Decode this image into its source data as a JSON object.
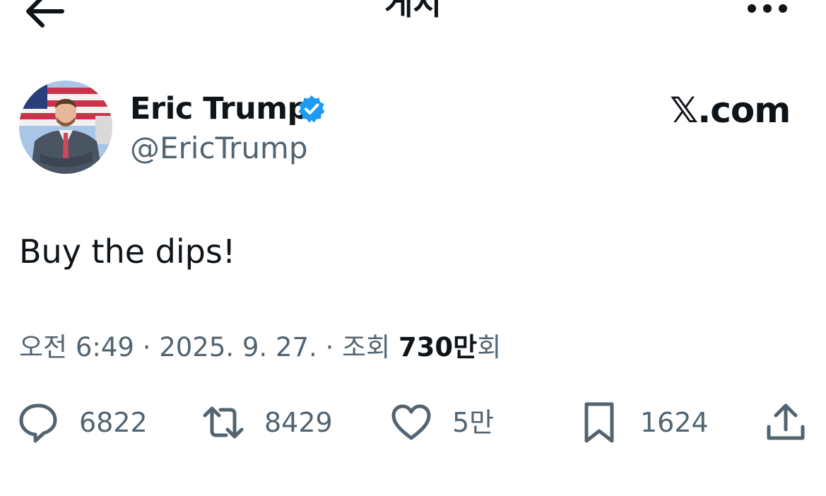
{
  "header": {
    "title": "게시",
    "back_icon": "arrow-left-icon",
    "more_icon": "more-horizontal-icon"
  },
  "author": {
    "name": "Eric Trump",
    "handle": "@EricTrump",
    "verified_color": "#1d9bf0"
  },
  "watermark": "𝕏.com",
  "tweet": {
    "text": "Buy the dips!"
  },
  "meta": {
    "prefix": "오전 6:49 · 2025. 9. 27. · 조회 ",
    "views": "730만",
    "suffix": "회"
  },
  "actions": {
    "replies": "6822",
    "retweets": "8429",
    "likes": "5만",
    "bookmarks": "1624"
  },
  "colors": {
    "text": "#0f1419",
    "secondary": "#536471"
  }
}
